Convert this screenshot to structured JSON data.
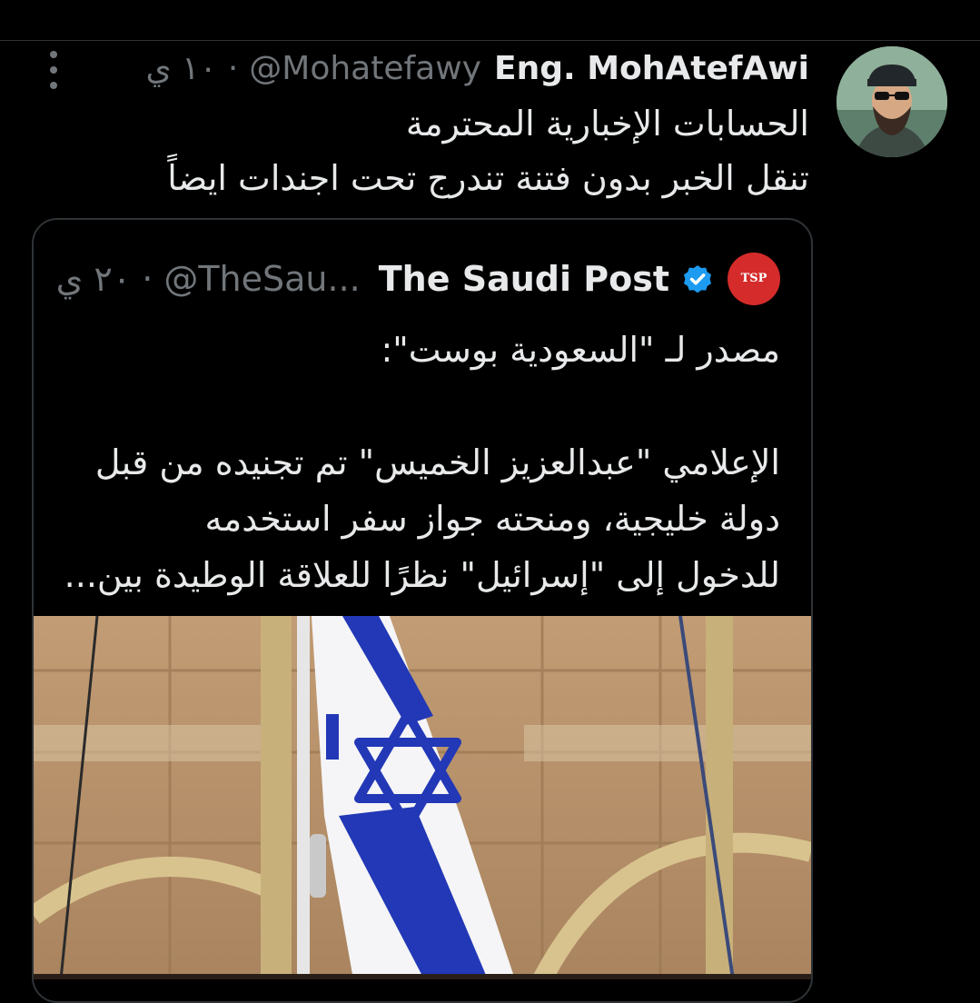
{
  "tweet": {
    "display_name": "Eng. MohAtefAwi",
    "handle": "@Mohatefawy",
    "separator": "·",
    "time": "١٠ ي",
    "text_lines": [
      "الحسابات الإخبارية المحترمة",
      "تنقل الخبر بدون فتنة تندرج تحت اجندات ايضاً"
    ]
  },
  "quoted_tweet": {
    "logo_text": "TSP",
    "display_name": "The Saudi Post",
    "handle": "@TheSau...",
    "separator": "·",
    "time": "٢٠ ي",
    "text_lines": [
      "مصدر لـ \"السعودية بوست\":",
      "",
      "الإعلامي \"عبدالعزيز الخميس\" تم تجنيده من قبل",
      "دولة خليجية، ومنحته جواز سفر استخدمه",
      "للدخول إلى \"إسرائيل\" نظرًا للعلاقة الوطيدة بين..."
    ]
  },
  "icons": {
    "more": "more-vertical-icon",
    "verified": "verified-badge-icon",
    "logo": "tsp-logo-icon"
  },
  "colors": {
    "background": "#000000",
    "primary_text": "#e7e9ea",
    "secondary_text": "#71767b",
    "border": "#2f3336",
    "verified_blue": "#1d9bf0",
    "logo_red": "#d52b2b",
    "flag_blue": "#1f3db8"
  }
}
